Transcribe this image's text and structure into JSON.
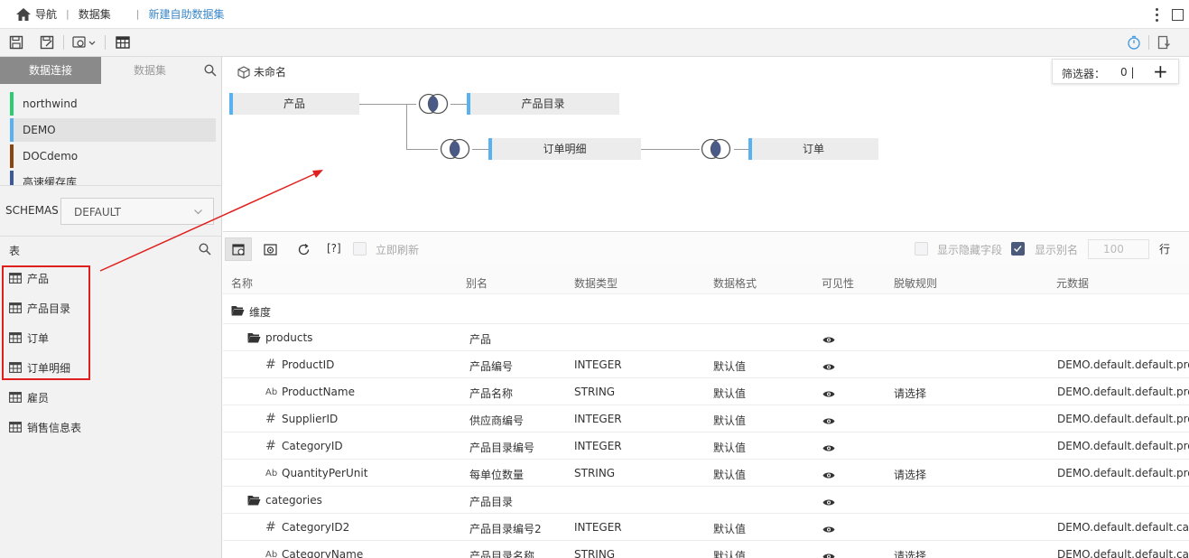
{
  "nav": {
    "home": "导航",
    "crumb1": "数据集",
    "crumb2": "新建自助数据集"
  },
  "left": {
    "tab_connection": "数据连接",
    "tab_dataset": "数据集",
    "connections": [
      {
        "label": "northwind",
        "color": "#2ecc71"
      },
      {
        "label": "DEMO",
        "color": "#5ab1ef"
      },
      {
        "label": "DOCdemo",
        "color": "#8b4513"
      },
      {
        "label": "高速缓存库",
        "color": "#3a5a99"
      }
    ],
    "schemas_label": "SCHEMAS",
    "schemas_value": "DEFAULT",
    "tables_label": "表",
    "tables": [
      "产品",
      "产品目录",
      "订单",
      "订单明细",
      "雇员",
      "销售信息表"
    ]
  },
  "canvas": {
    "title": "未命名",
    "filter_label": "筛选器：",
    "filter_count": "0 |",
    "filter_add": "+",
    "nodes": {
      "n1": "产品",
      "n2": "产品目录",
      "n3": "订单明细",
      "n4": "订单"
    }
  },
  "grid_toolbar": {
    "auto_refresh": "立即刷新",
    "show_hidden": "显示隐藏字段",
    "show_alias": "显示别名",
    "row_count": "100",
    "row_unit": "行",
    "bracket_btn": "[?]"
  },
  "grid": {
    "headers": [
      "名称",
      "别名",
      "数据类型",
      "数据格式",
      "可见性",
      "脱敏规则",
      "元数据"
    ],
    "group": "维度",
    "rows": [
      {
        "kind": "table",
        "name": "products",
        "alias": "产品",
        "type": "",
        "format": "",
        "mask": "",
        "meta": ""
      },
      {
        "kind": "num",
        "name": "ProductID",
        "alias": "产品编号",
        "type": "INTEGER",
        "format": "默认值",
        "mask": "",
        "meta": "DEMO.default.default.pro"
      },
      {
        "kind": "str",
        "name": "ProductName",
        "alias": "产品名称",
        "type": "STRING",
        "format": "默认值",
        "mask": "请选择",
        "meta": "DEMO.default.default.pro"
      },
      {
        "kind": "num",
        "name": "SupplierID",
        "alias": "供应商编号",
        "type": "INTEGER",
        "format": "默认值",
        "mask": "",
        "meta": "DEMO.default.default.pro"
      },
      {
        "kind": "num",
        "name": "CategoryID",
        "alias": "产品目录编号",
        "type": "INTEGER",
        "format": "默认值",
        "mask": "",
        "meta": "DEMO.default.default.pro"
      },
      {
        "kind": "str",
        "name": "QuantityPerUnit",
        "alias": "每单位数量",
        "type": "STRING",
        "format": "默认值",
        "mask": "请选择",
        "meta": "DEMO.default.default.pro"
      },
      {
        "kind": "table",
        "name": "categories",
        "alias": "产品目录",
        "type": "",
        "format": "",
        "mask": "",
        "meta": ""
      },
      {
        "kind": "num",
        "name": "CategoryID2",
        "alias": "产品目录编号2",
        "type": "INTEGER",
        "format": "默认值",
        "mask": "",
        "meta": "DEMO.default.default.cat"
      },
      {
        "kind": "str",
        "name": "CategoryName",
        "alias": "产品目录名称",
        "type": "STRING",
        "format": "默认值",
        "mask": "请选择",
        "meta": "DEMO.default.default.cat"
      }
    ]
  },
  "icons": {
    "num_glyph": "#",
    "str_glyph": "Ab"
  }
}
